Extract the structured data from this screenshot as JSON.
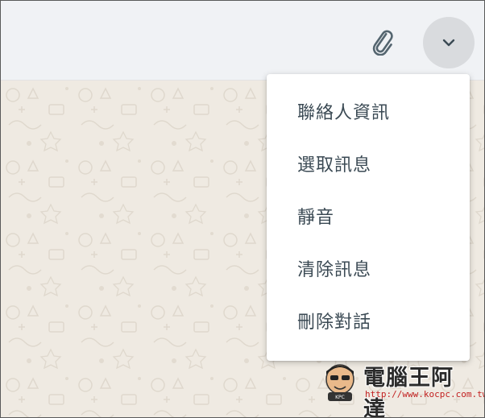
{
  "header": {
    "attach_icon": "paperclip-icon",
    "menu_toggle_icon": "chevron-down-icon"
  },
  "menu": {
    "items": [
      {
        "label": "聯絡人資訊"
      },
      {
        "label": "選取訊息"
      },
      {
        "label": "靜音"
      },
      {
        "label": "清除訊息"
      },
      {
        "label": "刪除對話"
      }
    ]
  },
  "watermark": {
    "title": "電腦王阿達",
    "url": "http://www.kocpc.com.tw"
  },
  "colors": {
    "header_bg": "#f0f2f5",
    "chat_bg": "#efeae2",
    "menu_text": "#3b4a54",
    "watermark_url": "#c22020"
  }
}
